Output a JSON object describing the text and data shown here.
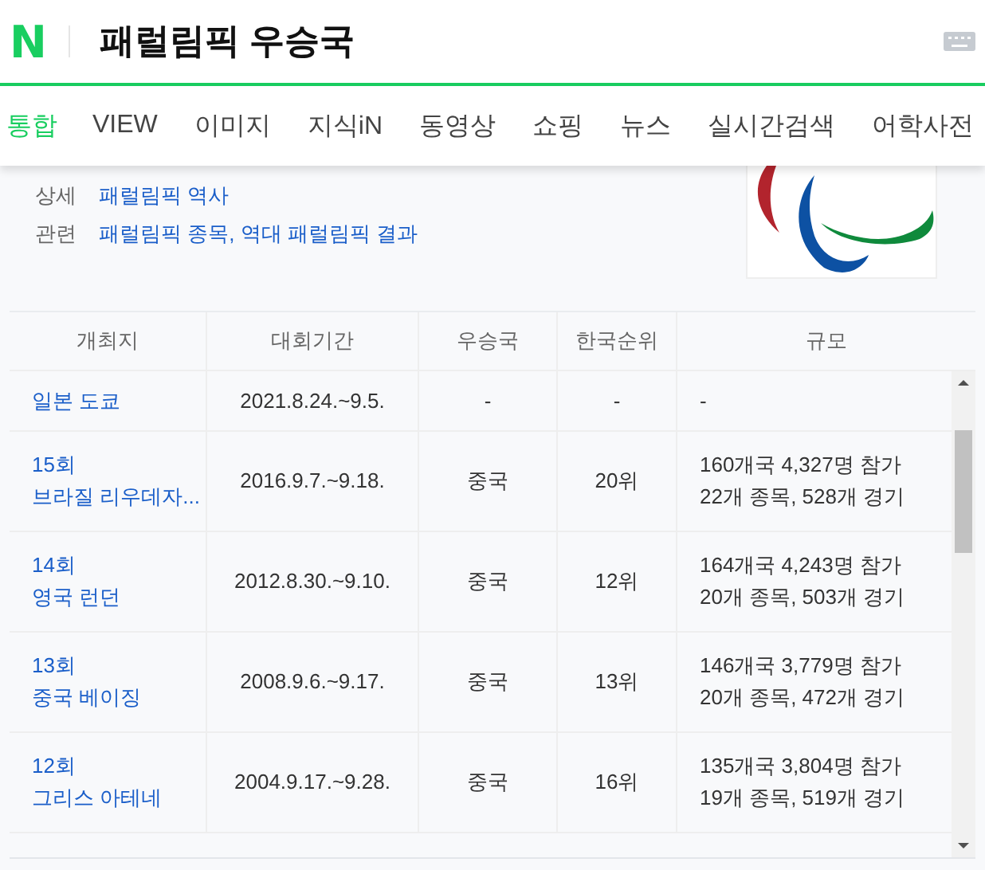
{
  "header": {
    "logo": "N",
    "query": "패럴림픽 우승국"
  },
  "tabs": [
    {
      "label": "통합",
      "selected": true
    },
    {
      "label": "VIEW",
      "selected": false
    },
    {
      "label": "이미지",
      "selected": false
    },
    {
      "label": "지식iN",
      "selected": false
    },
    {
      "label": "동영상",
      "selected": false
    },
    {
      "label": "쇼핑",
      "selected": false
    },
    {
      "label": "뉴스",
      "selected": false
    },
    {
      "label": "실시간검색",
      "selected": false
    },
    {
      "label": "어학사전",
      "selected": false
    }
  ],
  "info": [
    {
      "label": "상세",
      "value": "패럴림픽 역사"
    },
    {
      "label": "관련",
      "value": "패럴림픽 종목, 역대 패럴림픽 결과"
    }
  ],
  "table": {
    "columns": [
      "개최지",
      "대회기간",
      "우승국",
      "한국순위",
      "규모"
    ],
    "rows": [
      {
        "edition": "",
        "host": "일본 도쿄",
        "period": "2021.8.24.~9.5.",
        "winner": "-",
        "korea_rank": "-",
        "scale": [
          "-"
        ]
      },
      {
        "edition": "15회",
        "host": "브라질 리우데자...",
        "period": "2016.9.7.~9.18.",
        "winner": "중국",
        "korea_rank": "20위",
        "scale": [
          "160개국 4,327명 참가",
          "22개 종목, 528개 경기"
        ]
      },
      {
        "edition": "14회",
        "host": "영국 런던",
        "period": "2012.8.30.~9.10.",
        "winner": "중국",
        "korea_rank": "12위",
        "scale": [
          "164개국 4,243명 참가",
          "20개 종목, 503개 경기"
        ]
      },
      {
        "edition": "13회",
        "host": "중국 베이징",
        "period": "2008.9.6.~9.17.",
        "winner": "중국",
        "korea_rank": "13위",
        "scale": [
          "146개국 3,779명 참가",
          "20개 종목, 472개 경기"
        ]
      },
      {
        "edition": "12회",
        "host": "그리스 아테네",
        "period": "2004.9.17.~9.28.",
        "winner": "중국",
        "korea_rank": "16위",
        "scale": [
          "135개국 3,804명 참가",
          "19개 종목, 519개 경기"
        ]
      }
    ]
  }
}
